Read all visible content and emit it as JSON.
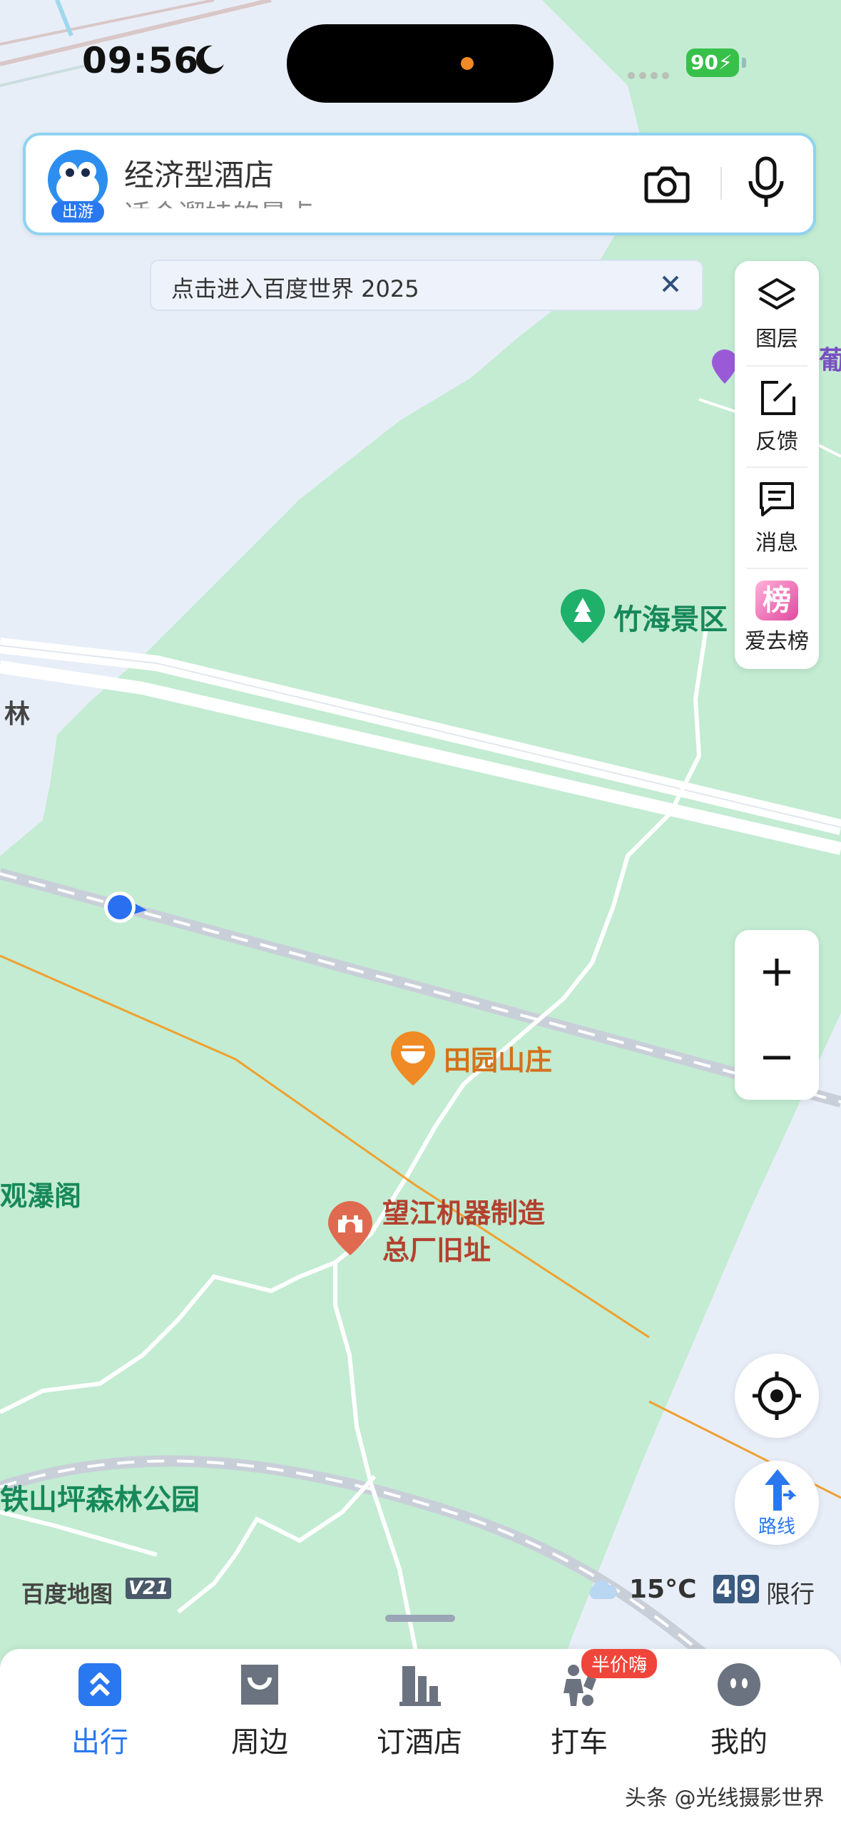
{
  "status_bar": {
    "time": "09:56",
    "battery": "90"
  },
  "search": {
    "query": "经济型酒店",
    "secondary": "适合遛娃的景点",
    "mascot_badge": "出游"
  },
  "banner": {
    "text": "点击进入百度世界 2025"
  },
  "toolbar": {
    "items": [
      {
        "label": "图层",
        "icon": "layers-icon"
      },
      {
        "label": "反馈",
        "icon": "feedback-icon"
      },
      {
        "label": "消息",
        "icon": "message-icon"
      },
      {
        "label": "爱去榜",
        "icon": "ranking-icon",
        "badge": "榜"
      }
    ]
  },
  "zoom": {
    "in": "+",
    "out": "−"
  },
  "route": {
    "label": "路线"
  },
  "map_labels": {
    "zhuhai": "竹海景区",
    "lin": "林",
    "tianyuan": "田园山庄",
    "wangjiang_line1": "望江机器制造",
    "wangjiang_line2": "总厂旧址",
    "guanpu": "观瀑阁",
    "tieshan": "铁山坪森林公园",
    "edge": "葡"
  },
  "brand": {
    "name": "百度地图",
    "version": "V21"
  },
  "weather": {
    "temp": "15°C"
  },
  "traffic_limit": {
    "digit1": "4",
    "digit2": "9",
    "text": "限行"
  },
  "tabs": [
    {
      "label": "出行",
      "icon": "travel-icon",
      "active": true
    },
    {
      "label": "周边",
      "icon": "nearby-icon",
      "active": false
    },
    {
      "label": "订酒店",
      "icon": "hotel-icon",
      "active": false
    },
    {
      "label": "打车",
      "icon": "taxi-icon",
      "active": false,
      "badge": "半价嗨"
    },
    {
      "label": "我的",
      "icon": "profile-icon",
      "active": false
    }
  ],
  "watermark": "头条 @光线摄影世界",
  "colors": {
    "accent": "#2a78f0",
    "park_green": "#c3ecd2",
    "water_blue": "#e8eef8"
  }
}
